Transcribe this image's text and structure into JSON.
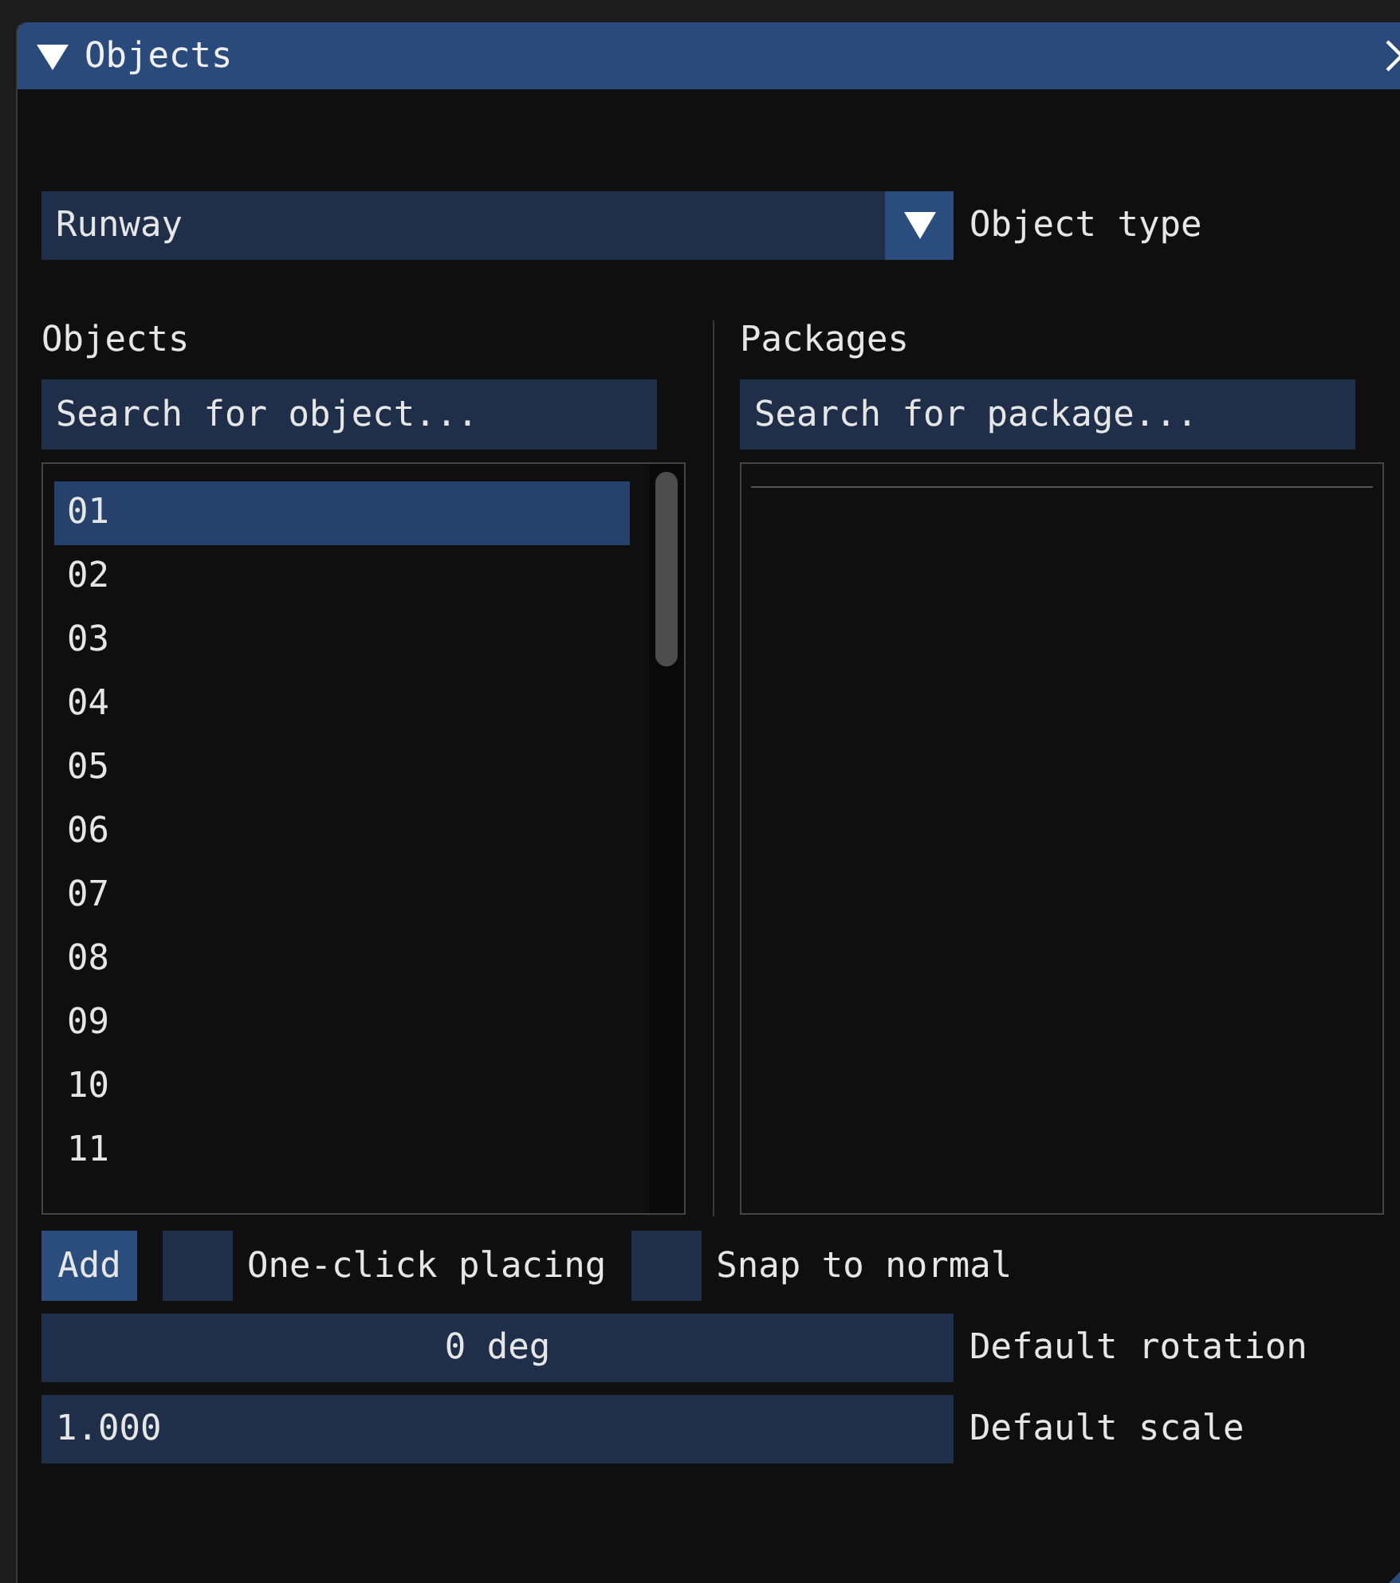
{
  "window": {
    "title": "Objects",
    "collapsed": false
  },
  "object_type": {
    "value": "Runway",
    "label": "Object type"
  },
  "objects": {
    "heading": "Objects",
    "search": {
      "placeholder": "Search for object..."
    },
    "items": [
      {
        "label": "01",
        "selected": true
      },
      {
        "label": "02",
        "selected": false
      },
      {
        "label": "03",
        "selected": false
      },
      {
        "label": "04",
        "selected": false
      },
      {
        "label": "05",
        "selected": false
      },
      {
        "label": "06",
        "selected": false
      },
      {
        "label": "07",
        "selected": false
      },
      {
        "label": "08",
        "selected": false
      },
      {
        "label": "09",
        "selected": false
      },
      {
        "label": "10",
        "selected": false
      },
      {
        "label": "11",
        "selected": false
      }
    ]
  },
  "packages": {
    "heading": "Packages",
    "search": {
      "placeholder": "Search for package..."
    }
  },
  "add_button": "Add",
  "options": [
    {
      "label": "One-click placing",
      "checked": false
    },
    {
      "label": "Snap to normal",
      "checked": false
    }
  ],
  "rotation": {
    "value": "0 deg",
    "label": "Default rotation"
  },
  "scale": {
    "value": "1.000",
    "label": "Default scale"
  }
}
